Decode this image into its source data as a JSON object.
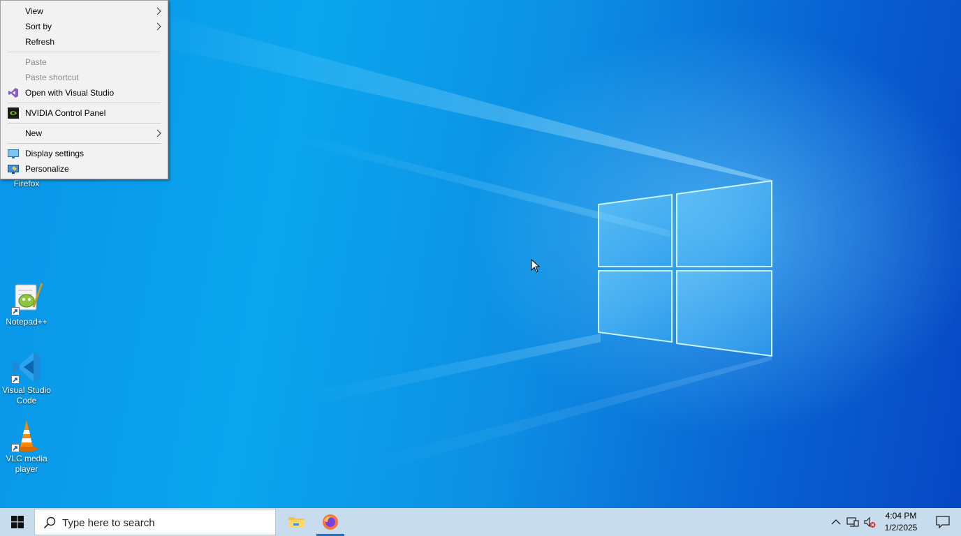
{
  "context_menu": {
    "items": [
      {
        "label": "View",
        "has_submenu": true,
        "disabled": false
      },
      {
        "label": "Sort by",
        "has_submenu": true,
        "disabled": false
      },
      {
        "label": "Refresh",
        "has_submenu": false,
        "disabled": false
      },
      {
        "label": "Paste",
        "has_submenu": false,
        "disabled": true
      },
      {
        "label": "Paste shortcut",
        "has_submenu": false,
        "disabled": true
      },
      {
        "label": "Open with Visual Studio",
        "icon": "visual-studio-icon",
        "has_submenu": false,
        "disabled": false
      },
      {
        "label": "NVIDIA Control Panel",
        "icon": "nvidia-icon",
        "has_submenu": false,
        "disabled": false
      },
      {
        "label": "New",
        "has_submenu": true,
        "disabled": false
      },
      {
        "label": "Display settings",
        "icon": "display-settings-icon",
        "has_submenu": false,
        "disabled": false
      },
      {
        "label": "Personalize",
        "icon": "personalize-icon",
        "has_submenu": false,
        "disabled": false
      }
    ]
  },
  "desktop_icons": {
    "firefox": {
      "label": "Firefox",
      "icon": "firefox-icon"
    },
    "notepadpp": {
      "label": "Notepad++",
      "icon": "notepadpp-icon"
    },
    "vscode": {
      "label": "Visual Studio Code",
      "icon": "vscode-icon"
    },
    "vlc": {
      "label": "VLC media player",
      "icon": "vlc-icon"
    }
  },
  "taskbar": {
    "start_icon": "windows-start-icon",
    "search_placeholder": "Type here to search",
    "pinned_apps": [
      {
        "name": "File Explorer",
        "icon": "file-explorer-icon",
        "active": false
      },
      {
        "name": "Firefox",
        "icon": "firefox-icon",
        "active": true
      }
    ],
    "tray": {
      "icons": [
        "chevron-up-icon",
        "network-icon",
        "volume-muted-icon"
      ],
      "time": "4:04 PM",
      "date": "1/2/2025"
    },
    "notification_icon": "action-center-icon"
  },
  "colors": {
    "desktop_blue": "#0a94e8",
    "taskbar_bg": "#c7dcec",
    "menu_bg": "#f2f2f2",
    "accent": "#1e6fc9"
  }
}
